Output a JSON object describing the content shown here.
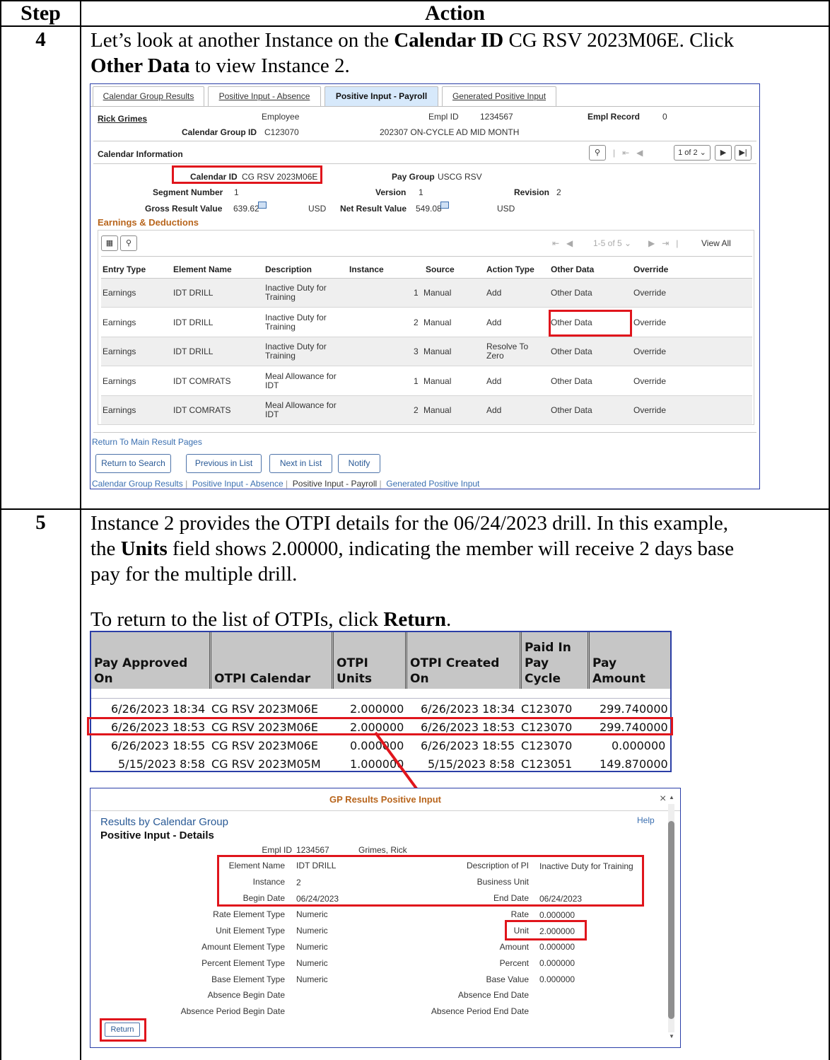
{
  "header": {
    "step": "Step",
    "action": "Action"
  },
  "step4": {
    "number": "4",
    "line1_a": "Let’s look at another Instance on the ",
    "line1_b": "Calendar ID",
    "line1_c": " CG RSV 2023M06E. Click",
    "line2_a": "Other Data",
    "line2_b": " to view Instance 2.",
    "screen": {
      "tabs": [
        "Calendar Group Results",
        "Positive Input - Absence",
        "Positive Input - Payroll",
        "Generated Positive Input"
      ],
      "employee_name": "Rick Grimes",
      "employee_label": "Employee",
      "empl_id_label": "Empl ID",
      "empl_id": "1234567",
      "empl_record_label": "Empl Record",
      "empl_record": "0",
      "calendar_group_id_label": "Calendar Group ID",
      "calendar_group_id": "C123070",
      "calendar_group_desc": "202307 ON-CYCLE AD MID MONTH",
      "calendar_info_title": "Calendar Information",
      "pager": "1 of 2",
      "calendar_id_label": "Calendar ID",
      "calendar_id": "CG RSV 2023M06E",
      "pay_group_label": "Pay Group",
      "pay_group": "USCG RSV",
      "segment_number_label": "Segment Number",
      "segment_number": "1",
      "version_label": "Version",
      "version": "1",
      "revision_label": "Revision",
      "revision": "2",
      "gross_result_label": "Gross Result Value",
      "gross_result": "639.62",
      "gross_currency": "USD",
      "net_result_label": "Net Result Value",
      "net_result": "549.08",
      "net_currency": "USD",
      "earnings_title": "Earnings & Deductions",
      "grid_pager": "1-5 of 5",
      "view_all": "View All",
      "columns": [
        "Entry Type",
        "Element Name",
        "Description",
        "Instance",
        "Source",
        "Action Type",
        "Other Data",
        "Override"
      ],
      "rows": [
        {
          "entry_type": "Earnings",
          "element": "IDT DRILL",
          "desc1": "Inactive Duty for",
          "desc2": "Training",
          "instance": "1",
          "source": "Manual",
          "action1": "Add",
          "action2": "",
          "other": "Other Data",
          "override": "Override"
        },
        {
          "entry_type": "Earnings",
          "element": "IDT DRILL",
          "desc1": "Inactive Duty for",
          "desc2": "Training",
          "instance": "2",
          "source": "Manual",
          "action1": "Add",
          "action2": "",
          "other": "Other Data",
          "override": "Override"
        },
        {
          "entry_type": "Earnings",
          "element": "IDT DRILL",
          "desc1": "Inactive Duty for",
          "desc2": "Training",
          "instance": "3",
          "source": "Manual",
          "action1": "Resolve To",
          "action2": "Zero",
          "other": "Other Data",
          "override": "Override"
        },
        {
          "entry_type": "Earnings",
          "element": "IDT COMRATS",
          "desc1": "Meal Allowance for",
          "desc2": "IDT",
          "instance": "1",
          "source": "Manual",
          "action1": "Add",
          "action2": "",
          "other": "Other Data",
          "override": "Override"
        },
        {
          "entry_type": "Earnings",
          "element": "IDT COMRATS",
          "desc1": "Meal Allowance for",
          "desc2": "IDT",
          "instance": "2",
          "source": "Manual",
          "action1": "Add",
          "action2": "",
          "other": "Other Data",
          "override": "Override"
        }
      ],
      "return_main": "Return To Main Result Pages",
      "buttons": [
        "Return to Search",
        "Previous in List",
        "Next in List",
        "Notify"
      ],
      "footer_links": [
        "Calendar Group Results",
        "Positive Input - Absence",
        "Positive Input - Payroll",
        "Generated Positive Input"
      ],
      "footer_sep": "|"
    }
  },
  "step5": {
    "number": "5",
    "p1_l1": "Instance 2 provides the OTPI details for the 06/24/2023 drill. In this example,",
    "p1_l2_a": "the ",
    "p1_l2_b": "Units",
    "p1_l2_c": " field shows 2.00000, indicating the member will receive 2 days base",
    "p1_l3": "pay for the multiple drill.",
    "p2_a": "To return to the list of OTPIs, click ",
    "p2_b": "Return",
    "p2_c": ".",
    "otpi": {
      "headers": [
        "Pay Approved On",
        "OTPI Calendar",
        "OTPI Units",
        "OTPI Created On",
        "Paid In Pay Cycle",
        "Pay Amount"
      ],
      "rows": [
        [
          "6/26/2023 18:34",
          "CG RSV 2023M06E",
          "2.000000",
          "6/26/2023 18:34",
          "C123070",
          "299.740000"
        ],
        [
          "6/26/2023 18:53",
          "CG RSV 2023M06E",
          "2.000000",
          "6/26/2023 18:53",
          "C123070",
          "299.740000"
        ],
        [
          "6/26/2023 18:55",
          "CG RSV 2023M06E",
          "0.000000",
          "6/26/2023 18:55",
          "C123070",
          "0.000000"
        ],
        [
          "5/15/2023 8:58",
          "CG RSV 2023M05M",
          "1.000000",
          "5/15/2023 8:58",
          "C123051",
          "149.870000"
        ]
      ]
    },
    "modal": {
      "title": "GP Results Positive Input",
      "close": "×",
      "subtitle": "Results by Calendar Group",
      "help": "Help",
      "section": "Positive Input - Details",
      "empl_id_label": "Empl ID",
      "empl_id": "1234567",
      "name": "Grimes, Rick",
      "left_labels": [
        "Element Name",
        "Instance",
        "Begin Date",
        "Rate Element Type",
        "Unit Element Type",
        "Amount Element Type",
        "Percent Element Type",
        "Base Element Type",
        "Absence Begin Date",
        "Absence Period Begin Date"
      ],
      "left_values": [
        "IDT DRILL",
        "2",
        "06/24/2023",
        "Numeric",
        "Numeric",
        "Numeric",
        "Numeric",
        "Numeric",
        "",
        ""
      ],
      "right_labels": [
        "Description of PI",
        "Business Unit",
        "End Date",
        "Rate",
        "Unit",
        "Amount",
        "Percent",
        "Base Value",
        "Absence End Date",
        "Absence Period End Date"
      ],
      "right_values": [
        "Inactive Duty for Training",
        "",
        "06/24/2023",
        "0.000000",
        "2.000000",
        "0.000000",
        "0.000000",
        "0.000000",
        "",
        ""
      ],
      "return_button": "Return"
    }
  },
  "colors": {
    "highlight_red": "#e0151c",
    "link_blue": "#3a6fb0",
    "frame_blue": "#2a3ea8"
  }
}
